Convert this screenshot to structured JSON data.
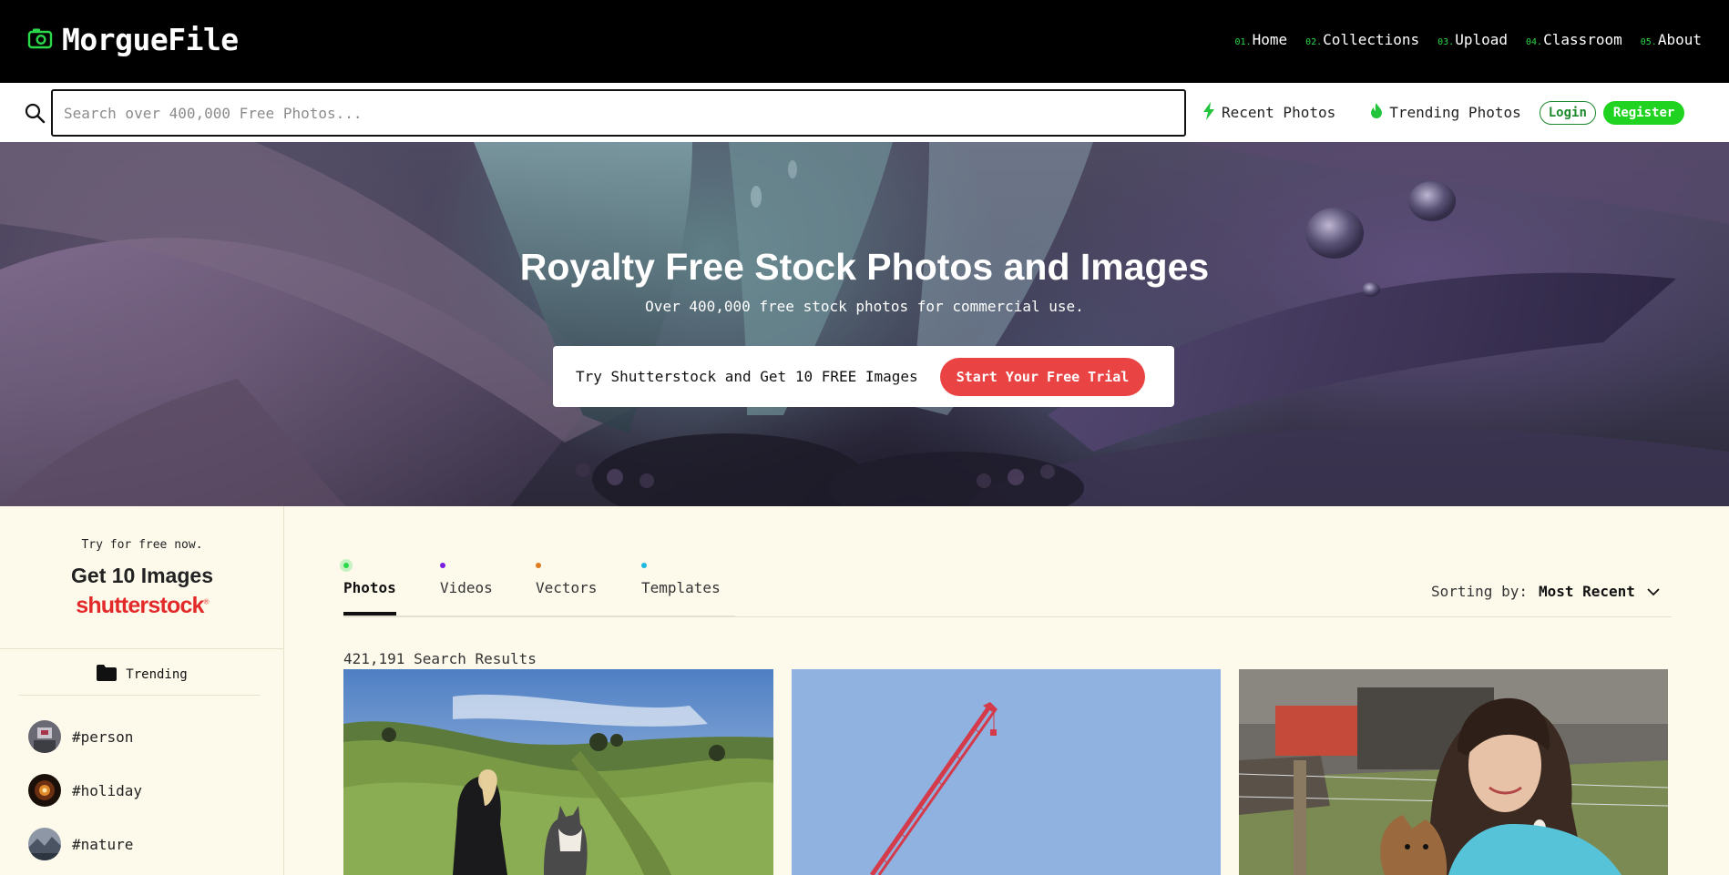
{
  "brand": {
    "name": "MorgueFile",
    "icon": "camera-icon",
    "color": "#2bd94a"
  },
  "nav": [
    {
      "num": "01.",
      "label": "Home"
    },
    {
      "num": "02.",
      "label": "Collections"
    },
    {
      "num": "03.",
      "label": "Upload"
    },
    {
      "num": "04.",
      "label": "Classroom"
    },
    {
      "num": "05.",
      "label": "About"
    }
  ],
  "search": {
    "placeholder": "Search over 400,000 Free Photos...",
    "value": ""
  },
  "quicklinks": [
    {
      "label": "Recent Photos",
      "icon": "bolt-icon"
    },
    {
      "label": "Trending Photos",
      "icon": "flame-icon"
    }
  ],
  "auth": {
    "login": "Login",
    "register": "Register"
  },
  "hero": {
    "title": "Royalty Free Stock Photos and Images",
    "subtitle": "Over 400,000 free stock photos for commercial use.",
    "promo_text": "Try Shutterstock and Get 10 FREE Images",
    "promo_button": "Start Your Free Trial"
  },
  "sidebar": {
    "try_text": "Try for free now.",
    "get_text": "Get 10 Images",
    "logo_text": "shutterstock",
    "logo_mark": "®",
    "trending_label": "Trending",
    "tags": [
      "#person",
      "#holiday",
      "#nature"
    ]
  },
  "tabs": [
    {
      "label": "Photos",
      "dot_color": "#2bd94a",
      "active": true
    },
    {
      "label": "Videos",
      "dot_color": "#7a1ee0",
      "active": false
    },
    {
      "label": "Vectors",
      "dot_color": "#e07a1e",
      "active": false
    },
    {
      "label": "Templates",
      "dot_color": "#1eb8e0",
      "active": false
    }
  ],
  "sorting": {
    "label": "Sorting by:",
    "value": "Most Recent"
  },
  "results_text": "421,191 Search Results",
  "colors": {
    "accent_green": "#21d321",
    "promo_red": "#ea4343",
    "background": "#fdfaec"
  }
}
